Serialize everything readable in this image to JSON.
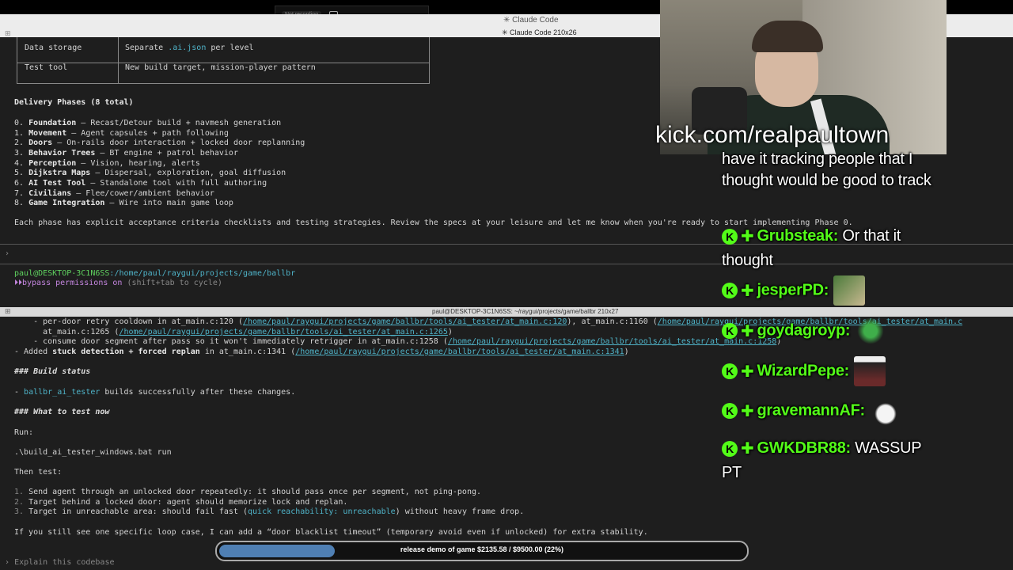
{
  "recording": {
    "label": "Not recording"
  },
  "window1": {
    "title": "✳ Claude Code",
    "subtitle": "✳ Claude Code 210x26"
  },
  "table": [
    {
      "key": "Data storage",
      "value_pre": "Separate ",
      "value_code": ".ai.json",
      "value_post": " per level"
    },
    {
      "key": "Test tool",
      "value": "New build target, mission-player pattern"
    }
  ],
  "phases": {
    "heading": "Delivery Phases (8 total)",
    "items": [
      {
        "num": "0. ",
        "name": "Foundation",
        "desc": " — Recast/Detour build + navmesh generation"
      },
      {
        "num": "1. ",
        "name": "Movement",
        "desc": " — Agent capsules + path following"
      },
      {
        "num": "2. ",
        "name": "Doors",
        "desc": " — On-rails door interaction + locked door replanning"
      },
      {
        "num": "3. ",
        "name": "Behavior Trees",
        "desc": " — BT engine + patrol behavior"
      },
      {
        "num": "4. ",
        "name": "Perception",
        "desc": " — Vision, hearing, alerts"
      },
      {
        "num": "5. ",
        "name": "Dijkstra Maps",
        "desc": " — Dispersal, exploration, goal diffusion"
      },
      {
        "num": "6. ",
        "name": "AI Test Tool",
        "desc": " — Standalone tool with full authoring"
      },
      {
        "num": "7. ",
        "name": "Civilians",
        "desc": " — Flee/cower/ambient behavior"
      },
      {
        "num": "8. ",
        "name": "Game Integration",
        "desc": " — Wire into main game loop"
      }
    ],
    "footer": "Each phase has explicit acceptance criteria checklists and testing strategies. Review the specs at your leisure and let me know when you're ready to start implementing Phase 0."
  },
  "prompt1": {
    "caret": "›",
    "user": "paul@DESKTOP-3C1N6SS",
    "path": ":/home/paul/raygui/projects/game/ballbr",
    "perm_icon": "⏵⏵",
    "perm": "bypass permissions on",
    "perm_hint": " (shift+tab to cycle)"
  },
  "window2": {
    "title": "paul@DESKTOP-3C1N6SS: ~/raygui/projects/game/ballbr 210x27"
  },
  "log": {
    "l1_pre": "    - per-door retry cooldown in at_main.c:120 (",
    "l1_link": "/home/paul/raygui/projects/game/ballbr/tools/ai_tester/at_main.c:120",
    "l1_mid": "), at_main.c:1160 (",
    "l1_link2": "/home/paul/raygui/projects/game/ballbr/tools/ai_tester/at_main.c",
    "l2_pre": "      at_main.c:1265 (",
    "l2_link": "/home/paul/raygui/projects/game/ballbr/tools/ai_tester/at_main.c:1265",
    "l2_post": ")",
    "l3_pre": "    - consume door segment after pass so it won't immediately retrigger in at_main.c:1258 (",
    "l3_link": "/home/paul/raygui/projects/game/ballbr/tools/ai_tester/at_main.c:1258",
    "l3_post": ")",
    "l4_pre": "- Added ",
    "l4_bold": "stuck detection + forced replan",
    "l4_mid": " in at_main.c:1341 (",
    "l4_link": "/home/paul/raygui/projects/game/ballbr/tools/ai_tester/at_main.c:1341",
    "l4_post": ")",
    "h_build": "### Build status",
    "build_pre": "- ",
    "build_code": "ballbr_ai_tester",
    "build_post": " builds successfully after these changes.",
    "h_test": "### What to test now",
    "run": "Run:",
    "cmd": ".\\build_ai_tester_windows.bat run",
    "then": "Then test:",
    "t1_num": "1. ",
    "t1": "Send agent through an unlocked door repeatedly: it should pass once per segment, not ping-pong.",
    "t2_num": "2. ",
    "t2": "Target behind a locked door: agent should memorize lock and replan.",
    "t3_num": "3. ",
    "t3_pre": "Target in unreachable area: should fail fast (",
    "t3_code": "quick reachability: unreachable",
    "t3_post": ") without heavy frame drop.",
    "footer": "If you still see one specific loop case, I can add a “door blacklist timeout” (temporary avoid even if unlocked) for extra stability."
  },
  "input": {
    "caret": "›",
    "placeholder": "Explain this codebase"
  },
  "stream": {
    "kick_url": "kick.com/realpaultown",
    "messages": [
      {
        "text": "have it tracking people that I thought would be good to track"
      },
      {
        "user": "Grubsteak:",
        "text": " Or that it thought"
      },
      {
        "user": "jesperPD:",
        "emote": true
      },
      {
        "user": "goydagroyp:",
        "emote": true
      },
      {
        "user": "WizardPepe:",
        "emote": true
      },
      {
        "user": "gravemannAF:",
        "emote": true
      },
      {
        "user": "GWKDBR88:",
        "text": " WASSUP PT"
      }
    ],
    "badge_letter": "K",
    "badge_plus": "✚"
  },
  "goal": {
    "text": "release demo of game $2135.58 / $9500.00 (22%)",
    "progress": 0.22
  },
  "colors": {
    "kick_green": "#53fc18",
    "link": "#4fb3c8",
    "progress": "#4f7fb3"
  }
}
